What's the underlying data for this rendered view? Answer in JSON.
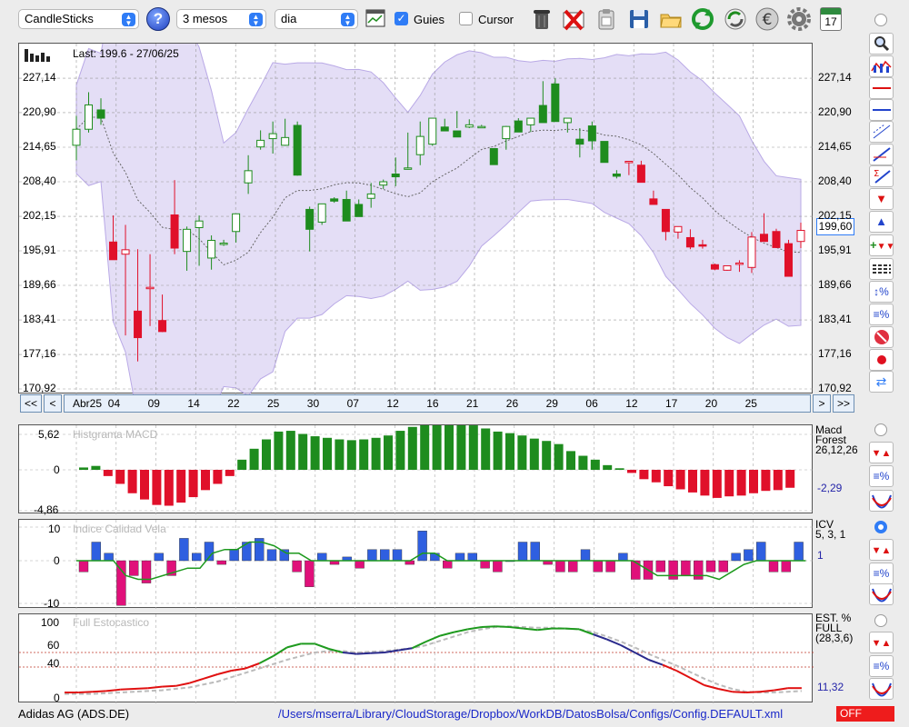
{
  "toolbar": {
    "chart_type": "CandleSticks",
    "period": "3 mesos",
    "interval": "dia",
    "guides_label": "Guies",
    "guides_checked": true,
    "cursor_label": "Cursor",
    "cursor_checked": false,
    "help_symbol": "?",
    "calendar_day": "17"
  },
  "main": {
    "info": "Last: 199.6 - 27/06/25",
    "last_price_badge": "199,60"
  },
  "navigation": {
    "first": "<<",
    "prev": "<",
    "next": ">",
    "last": ">>",
    "dates": [
      "Abr25",
      "04",
      "09",
      "14",
      "22",
      "25",
      "30",
      "07",
      "12",
      "16",
      "21",
      "26",
      "29",
      "06",
      "12",
      "17",
      "20",
      "25"
    ]
  },
  "macd_panel": {
    "title": "Histgrama MACD",
    "name_line1": "Macd",
    "name_line2": "Forest",
    "params": "26,12,26",
    "value": "-2,29",
    "axis": [
      "5,62",
      "0",
      "-4,86"
    ]
  },
  "icv_panel": {
    "title": "Indice Calidad Vela",
    "name": "ICV",
    "params": "5, 3, 1",
    "value": "1",
    "axis": [
      "10",
      "0",
      "-10"
    ]
  },
  "stoch_panel": {
    "title": "Full Estocastico",
    "name_line1": "EST. %",
    "name_line2": "FULL",
    "params": "(28,3,6)",
    "value": "11,32",
    "axis": [
      "100",
      "60",
      "40",
      "0"
    ]
  },
  "status": {
    "ticker": "Adidas AG (ADS.DE)",
    "path": "/Users/mserra/Library/CloudStorage/Dropbox/WorkDB/DatosBolsa/Configs/Config.DEFAULT.xml",
    "indicator": "OFF"
  },
  "colors": {
    "up": "#1e8c1e",
    "down": "#e0102a",
    "band_fill": "#d9d0f2",
    "accent": "#2f7cf6",
    "hist_pos": "#1e8c1e",
    "hist_neg": "#e0102a",
    "icv_pos": "#2f5fe0",
    "icv_neg": "#e0107a",
    "stoch_up": "#1e9a1e",
    "stoch_down": "#e01010",
    "stoch_mid": "#2a2a8c",
    "stoch_signal": "#bbbbbb"
  },
  "chart_data": [
    {
      "type": "candlestick",
      "title": "Last: 199.6 - 27/06/25",
      "y_ticks": [
        "227,14",
        "220,90",
        "214,65",
        "208,40",
        "202,15",
        "195,91",
        "189,66",
        "183,41",
        "177,16",
        "170,92"
      ],
      "ylim": [
        170.92,
        233.39
      ],
      "x_ticks": [
        "Abr25",
        "04",
        "09",
        "14",
        "22",
        "25",
        "30",
        "07",
        "12",
        "16",
        "21",
        "26",
        "29",
        "06",
        "12",
        "17",
        "20",
        "25"
      ],
      "ohlc_approx": [
        [
          215.0,
          220.3,
          212.3,
          217.9
        ],
        [
          217.9,
          224.6,
          217.3,
          222.3
        ],
        [
          221.4,
          223.5,
          218.7,
          219.9
        ],
        [
          197.5,
          202.3,
          194.3,
          194.3
        ],
        [
          195.3,
          200.6,
          180.6,
          196.1
        ],
        [
          185.0,
          196.2,
          175.9,
          180.2
        ],
        [
          189.3,
          195.3,
          182.3,
          189.3
        ],
        [
          183.3,
          188.0,
          181.2,
          181.3
        ],
        [
          202.4,
          208.7,
          195.3,
          196.4
        ],
        [
          195.8,
          200.3,
          192.3,
          199.8
        ],
        [
          200.1,
          202.3,
          193.2,
          201.3
        ],
        [
          194.6,
          198.7,
          192.5,
          197.8
        ],
        [
          197.3,
          197.9,
          196.8,
          197.3
        ],
        [
          199.4,
          202.3,
          197.4,
          202.6
        ],
        [
          208.2,
          213.2,
          206.2,
          210.4
        ],
        [
          214.7,
          217.7,
          214.2,
          215.9
        ],
        [
          216.2,
          219.3,
          213.5,
          217.1
        ],
        [
          215.0,
          219.8,
          214.9,
          216.4
        ],
        [
          218.6,
          219.3,
          209.5,
          209.6
        ],
        [
          203.4,
          203.9,
          195.8,
          199.8
        ],
        [
          201.1,
          203.9,
          200.6,
          204.4
        ],
        [
          205.3,
          205.6,
          204.6,
          204.9
        ],
        [
          205.2,
          206.8,
          201.3,
          201.3
        ],
        [
          204.3,
          205.2,
          202.5,
          202.1
        ],
        [
          205.4,
          208.2,
          203.7,
          206.2
        ],
        [
          207.8,
          208.8,
          207.1,
          208.4
        ],
        [
          209.8,
          212.8,
          207.6,
          209.3
        ],
        [
          210.8,
          217.3,
          210.6,
          210.9
        ],
        [
          213.3,
          219.3,
          211.4,
          216.6
        ],
        [
          215.2,
          218.5,
          214.9,
          219.9
        ],
        [
          218.3,
          219.8,
          217.6,
          217.6
        ],
        [
          217.6,
          221.2,
          218.1,
          216.5
        ],
        [
          218.3,
          219.7,
          218.1,
          218.7
        ],
        [
          218.4,
          218.7,
          218.2,
          218.4
        ],
        [
          214.4,
          214.2,
          213.1,
          211.5
        ],
        [
          216.2,
          218.5,
          214.2,
          218.4
        ],
        [
          219.4,
          219.9,
          217.6,
          217.4
        ],
        [
          218.7,
          218.8,
          217.4,
          219.9
        ],
        [
          222.2,
          220.6,
          226.6,
          219.1
        ],
        [
          226.1,
          227.1,
          219.6,
          219.3
        ],
        [
          219.1,
          219.6,
          217.3,
          219.9
        ],
        [
          216.1,
          218.1,
          212.8,
          215.2
        ],
        [
          218.5,
          219.3,
          214.2,
          215.8
        ],
        [
          215.7,
          214.5,
          214.2,
          211.9
        ],
        [
          209.8,
          210.5,
          209.0,
          209.4
        ],
        [
          212.1,
          212.1,
          209.6,
          212.1
        ],
        [
          211.4,
          212.2,
          208.3,
          208.3
        ],
        [
          205.3,
          206.8,
          204.3,
          204.3
        ],
        [
          203.4,
          201.4,
          197.8,
          199.4
        ],
        [
          199.3,
          200.1,
          198.1,
          200.3
        ],
        [
          198.3,
          199.8,
          196.2,
          196.6
        ],
        [
          197.0,
          197.9,
          196.3,
          196.8
        ],
        [
          193.4,
          193.6,
          192.4,
          192.6
        ],
        [
          192.4,
          192.5,
          192.3,
          193.2
        ],
        [
          193.6,
          194.2,
          192.1,
          193.7
        ],
        [
          192.9,
          199.3,
          191.9,
          198.4
        ],
        [
          198.9,
          202.7,
          197.6,
          197.6
        ],
        [
          199.4,
          199.9,
          196.4,
          196.5
        ],
        [
          197.2,
          197.9,
          193.2,
          191.3
        ],
        [
          197.6,
          201.0,
          196.4,
          199.6
        ]
      ],
      "up_down_approx": [
        1,
        1,
        1,
        1,
        1,
        0,
        0,
        0,
        0,
        1,
        1,
        1,
        1,
        1,
        1,
        1,
        1,
        1,
        1,
        1,
        1,
        1,
        1,
        1,
        1,
        1,
        1,
        1,
        1,
        1,
        1,
        1,
        1,
        1,
        1,
        1,
        1,
        1,
        1,
        1,
        1,
        1,
        1,
        1,
        1,
        0,
        0,
        0,
        0,
        0,
        0,
        0,
        0,
        0,
        0,
        1,
        1,
        1,
        1,
        1
      ],
      "note": "approximate"
    },
    {
      "type": "bar",
      "title": "Histgrama MACD",
      "values_approx": [
        0.3,
        0.5,
        -0.8,
        -1.8,
        -3.0,
        -3.8,
        -4.5,
        -4.6,
        -4.2,
        -3.5,
        -2.6,
        -1.8,
        -0.8,
        1.3,
        2.7,
        3.9,
        4.9,
        5.0,
        4.6,
        4.3,
        4.1,
        3.9,
        3.8,
        3.9,
        4.1,
        4.4,
        5.0,
        5.5,
        5.8,
        5.9,
        6.0,
        5.9,
        5.7,
        5.3,
        4.9,
        4.7,
        4.4,
        4.0,
        3.7,
        3.3,
        2.4,
        1.8,
        1.3,
        0.6,
        0.2,
        -0.4,
        -1.2,
        -1.6,
        -2.1,
        -2.5,
        -2.9,
        -3.3,
        -3.6,
        -3.4,
        -3.3,
        -3.0,
        -2.7,
        -2.6,
        -2.3
      ],
      "ylim": [
        -4.86,
        5.62
      ]
    },
    {
      "type": "bar",
      "title": "Indice Calidad Vela",
      "values_approx": [
        -3,
        5,
        2,
        -12,
        -4,
        -6,
        2,
        -4,
        6,
        2,
        5,
        -1,
        3,
        5,
        6,
        3,
        3,
        -3,
        -7,
        2,
        -1,
        1,
        -2,
        3,
        3,
        3,
        -1,
        8,
        2,
        -2,
        2,
        2,
        -2,
        -3,
        0,
        5,
        5,
        -1,
        -3,
        -3,
        3,
        -3,
        -3,
        2,
        -5,
        -5,
        -3,
        -5,
        -4,
        -5,
        -3,
        -3,
        2,
        3,
        5,
        -3,
        -3,
        5
      ],
      "ylim": [
        -10,
        10
      ],
      "line_approx": [
        0,
        0,
        0,
        0,
        -4,
        -5,
        -5,
        -4,
        -3,
        -2,
        -2,
        2,
        3,
        3,
        5,
        5,
        4,
        2,
        2,
        0,
        0,
        0,
        0,
        0,
        0,
        0,
        0,
        0,
        2,
        2,
        0,
        0,
        0,
        0,
        0,
        0,
        0,
        0,
        0,
        0,
        0,
        0,
        0,
        0,
        0,
        0,
        -2,
        -4,
        -4,
        -4,
        -4,
        -4,
        -5,
        -3,
        -1,
        0,
        0,
        0,
        0,
        0
      ]
    },
    {
      "type": "line",
      "title": "Full Estocastico",
      "ylim": [
        0,
        100
      ],
      "series": [
        {
          "values_approx": [
            5,
            5,
            6,
            7,
            9,
            10,
            11,
            13,
            14,
            18,
            24,
            30,
            35,
            38,
            45,
            55,
            67,
            72,
            72,
            65,
            60,
            58,
            59,
            60,
            63,
            66,
            75,
            83,
            88,
            92,
            95,
            96,
            95,
            93,
            91,
            93,
            93,
            92,
            85,
            78,
            70,
            60,
            50,
            43,
            35,
            25,
            15,
            10,
            6,
            5,
            6,
            8,
            11,
            11
          ],
          "name": ""
        },
        {
          "values_approx": [
            3,
            3,
            3,
            4,
            5,
            6,
            7,
            8,
            10,
            12,
            16,
            20,
            26,
            32,
            38,
            44,
            50,
            55,
            60,
            62,
            62,
            60,
            61,
            62,
            64,
            66,
            70,
            76,
            82,
            88,
            92,
            95,
            96,
            95,
            94,
            94,
            93,
            92,
            88,
            82,
            75,
            67,
            58,
            50,
            42,
            33,
            24,
            16,
            10,
            6,
            5,
            5,
            6,
            7
          ],
          "name": ""
        }
      ]
    }
  ]
}
